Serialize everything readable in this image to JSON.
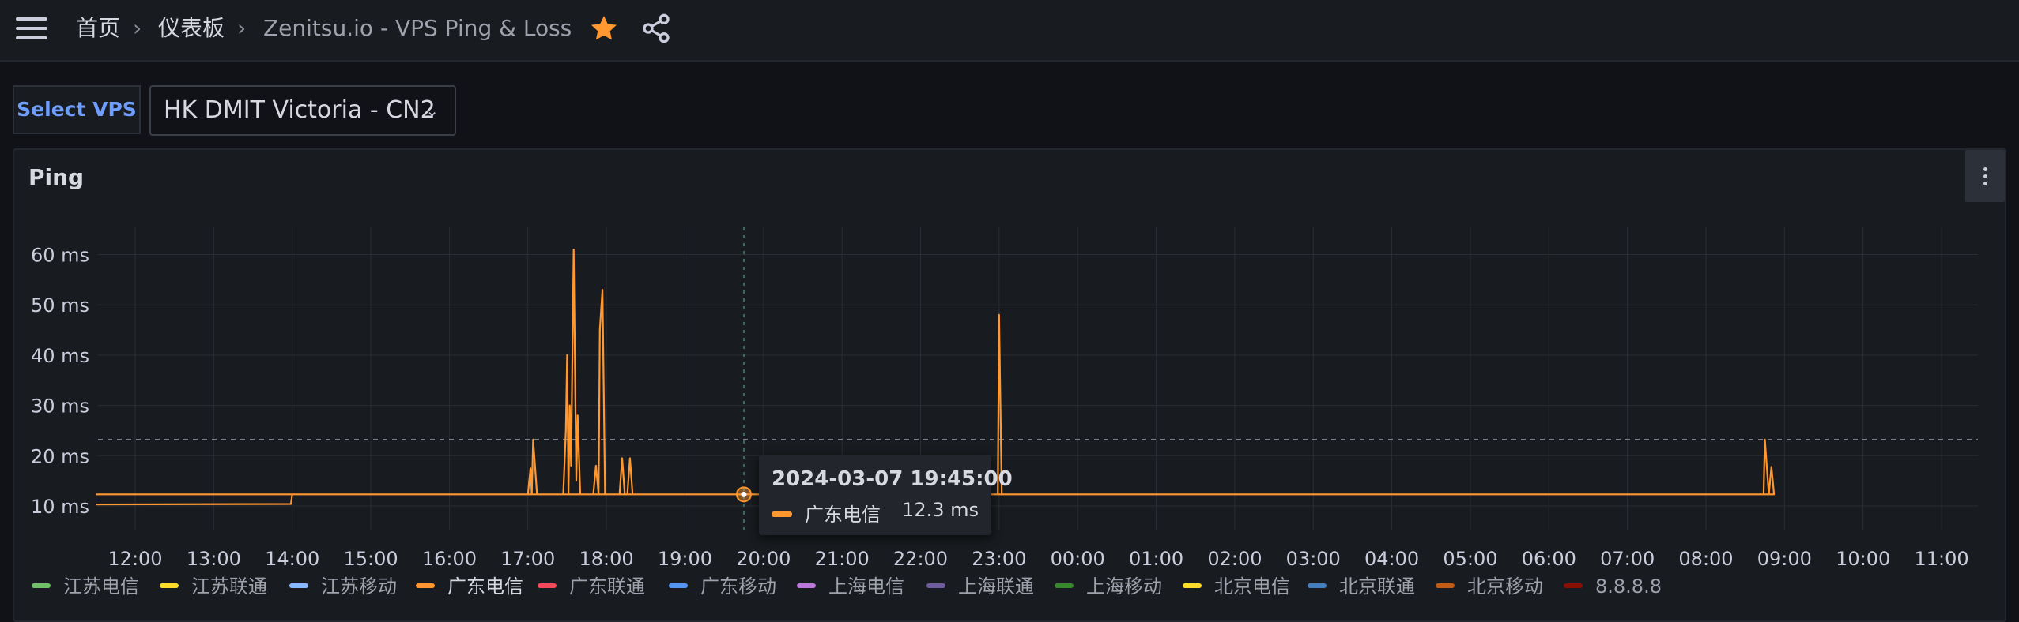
{
  "breadcrumb": {
    "home": "首页",
    "dashboards": "仪表板",
    "current": "Zenitsu.io - VPS Ping & Loss",
    "separator": "›"
  },
  "icons": {
    "menu": "hamburger-icon",
    "favorite": "star-icon",
    "share": "share-icon",
    "panel_menu": "vertical-dots-icon"
  },
  "variables": {
    "label": "Select VPS",
    "selected": "HK DMIT Victoria - CN2",
    "chevron": "⌄"
  },
  "panel": {
    "title": "Ping"
  },
  "colors": {
    "accent": "#ff9830",
    "background": "#111217",
    "panel": "#181b1f",
    "variable_label": "#6e9fff"
  },
  "tooltip": {
    "time": "2024-03-07 19:45:00",
    "series": "广东电信",
    "value": "12.3 ms"
  },
  "legend": [
    {
      "name": "江苏电信",
      "color": "#73bf69"
    },
    {
      "name": "江苏联通",
      "color": "#fade2a"
    },
    {
      "name": "江苏移动",
      "color": "#8ab8ff"
    },
    {
      "name": "广东电信",
      "color": "#ff9830",
      "active": true
    },
    {
      "name": "广东联通",
      "color": "#f2495c"
    },
    {
      "name": "广东移动",
      "color": "#5794f2"
    },
    {
      "name": "上海电信",
      "color": "#b877d9"
    },
    {
      "name": "上海联通",
      "color": "#705da0"
    },
    {
      "name": "上海移动",
      "color": "#37872d"
    },
    {
      "name": "北京电信",
      "color": "#fade2a"
    },
    {
      "name": "北京联通",
      "color": "#447ebc"
    },
    {
      "name": "北京移动",
      "color": "#c15c17"
    },
    {
      "name": "8.8.8.8",
      "color": "#890f02"
    }
  ],
  "chart_data": {
    "type": "line",
    "title": "Ping",
    "y_ticks": [
      "10 ms",
      "20 ms",
      "30 ms",
      "40 ms",
      "50 ms",
      "60 ms"
    ],
    "x_ticks": [
      "12:00",
      "13:00",
      "14:00",
      "15:00",
      "16:00",
      "17:00",
      "18:00",
      "19:00",
      "20:00",
      "21:00",
      "22:00",
      "23:00",
      "00:00",
      "01:00",
      "02:00",
      "03:00",
      "04:00",
      "05:00",
      "06:00",
      "07:00",
      "08:00",
      "09:00",
      "10:00",
      "11:00"
    ],
    "ylim": [
      10,
      60
    ],
    "grid": true,
    "legend_position": "bottom",
    "threshold_ms": 23.2,
    "cursor_time": "19:45",
    "series": [
      {
        "name": "广东电信",
        "color": "#ff9830",
        "points": [
          [
            "11:30",
            10.3
          ],
          [
            "13:59",
            10.4
          ],
          [
            "14:00",
            12.3
          ],
          [
            "17:00",
            12.3
          ],
          [
            "17:02",
            17.5
          ],
          [
            "17:03",
            12.3
          ],
          [
            "17:04",
            23.2
          ],
          [
            "17:07",
            12.3
          ],
          [
            "17:27",
            12.3
          ],
          [
            "17:29",
            25
          ],
          [
            "17:30",
            40
          ],
          [
            "17:31",
            12.3
          ],
          [
            "17:32",
            30
          ],
          [
            "17:33",
            18
          ],
          [
            "17:35",
            61
          ],
          [
            "17:37",
            15
          ],
          [
            "17:38",
            28
          ],
          [
            "17:40",
            12.3
          ],
          [
            "17:50",
            12.3
          ],
          [
            "17:52",
            18
          ],
          [
            "17:54",
            12.3
          ],
          [
            "17:55",
            45
          ],
          [
            "17:57",
            53
          ],
          [
            "17:59",
            12.3
          ],
          [
            "18:10",
            12.3
          ],
          [
            "18:12",
            19.5
          ],
          [
            "18:14",
            12.3
          ],
          [
            "18:16",
            12.3
          ],
          [
            "18:18",
            19.5
          ],
          [
            "18:20",
            12.3
          ],
          [
            "22:59",
            12.3
          ],
          [
            "23:00",
            48
          ],
          [
            "23:02",
            12.3
          ],
          [
            "08:44",
            12.3
          ],
          [
            "08:45",
            23.2
          ],
          [
            "08:48",
            12.3
          ],
          [
            "08:50",
            17.8
          ],
          [
            "08:52",
            12.3
          ],
          [
            "11:30",
            12.3
          ]
        ]
      }
    ]
  }
}
